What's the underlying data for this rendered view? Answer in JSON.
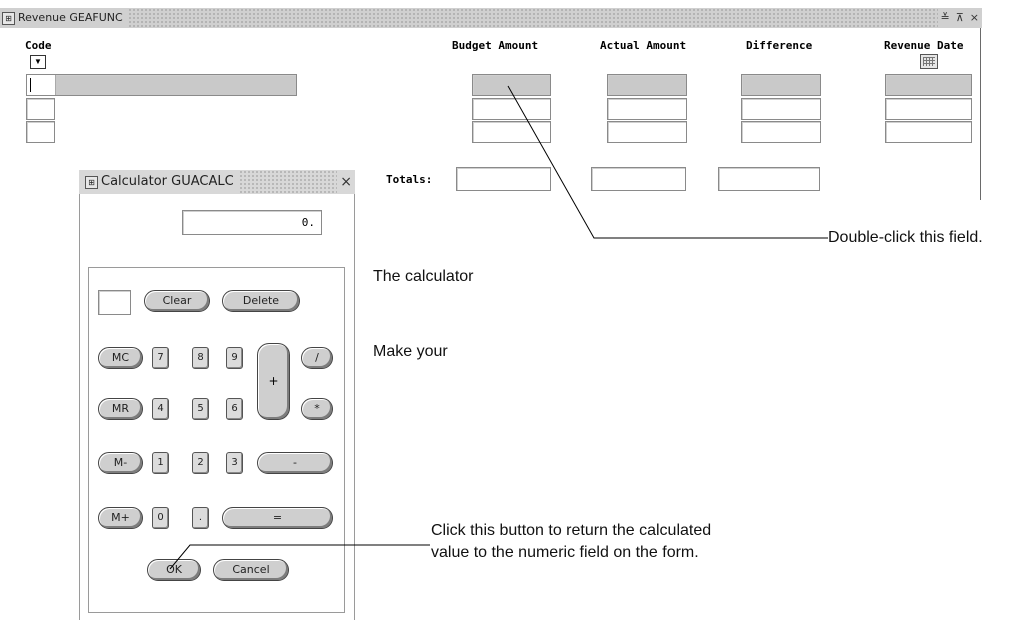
{
  "revenue_window": {
    "title": "Revenue  GEAFUNC",
    "icon": "app-icon",
    "controls": [
      "≚",
      "⊼",
      "×"
    ],
    "columns": {
      "code": "Code",
      "budget": "Budget Amount",
      "actual": "Actual Amount",
      "difference": "Difference",
      "revenue_date": "Revenue Date"
    },
    "code_dropdown_glyph": "▼",
    "totals_label": "Totals:"
  },
  "calculator": {
    "title": "Calculator  GUACALC",
    "close_glyph": "×",
    "display_value": "0.",
    "buttons": {
      "clear": "Clear",
      "delete": "Delete",
      "mc": "MC",
      "mr": "MR",
      "mminus": "M-",
      "mplus": "M+",
      "k7": "7",
      "k8": "8",
      "k9": "9",
      "k4": "4",
      "k5": "5",
      "k6": "6",
      "k1": "1",
      "k2": "2",
      "k3": "3",
      "k0": "0",
      "dot": ".",
      "plus": "+",
      "divide": "/",
      "multiply": "*",
      "minus": "-",
      "equals": "=",
      "ok": "OK",
      "cancel": "Cancel"
    }
  },
  "annotations": {
    "double_click": "Double-click this field.",
    "calculator_note": "The calculator",
    "make_your": "Make your",
    "ok_line1": "Click this button to return the calculated",
    "ok_line2": "value to the numeric field on the form."
  },
  "colors": {
    "field_shade": "#c9c9c9",
    "button_face": "#cfcfcf"
  }
}
